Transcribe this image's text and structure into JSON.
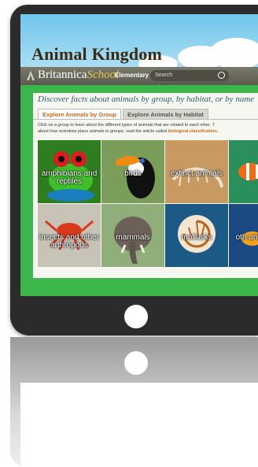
{
  "header": {
    "title": "Animal Kingdom",
    "brand": "Britannica",
    "brand_school": "School",
    "level": "Elementary",
    "search_placeholder": "Search"
  },
  "main": {
    "subtitle": "Discover facts about animals by group, by habitat, or by name",
    "tabs": [
      {
        "label": "Explore Animals by Group",
        "active": true
      },
      {
        "label": "Explore Animals by Habitat",
        "active": false
      }
    ],
    "description_line1": "Click on a group to learn about the different types of animals that are related to each other. T",
    "description_line2": "about how scientists place animals in groups, read the article called",
    "description_link": "biological classification.",
    "groups": [
      {
        "label": "amphibians and reptiles",
        "icon": "frog"
      },
      {
        "label": "birds",
        "icon": "toucan"
      },
      {
        "label": "extinct animals",
        "icon": "fossil"
      },
      {
        "label": "",
        "icon": "clownfish"
      },
      {
        "label": "insects and other arthropods",
        "icon": "crab"
      },
      {
        "label": "mammals",
        "icon": "elephant"
      },
      {
        "label": "mollusks",
        "icon": "nautilus"
      },
      {
        "label": "oth ani",
        "icon": "fish"
      }
    ]
  },
  "colors": {
    "frame": "#2b2b2b",
    "screen_bg": "#3cb64a",
    "tab_active": "#c56a1a"
  }
}
